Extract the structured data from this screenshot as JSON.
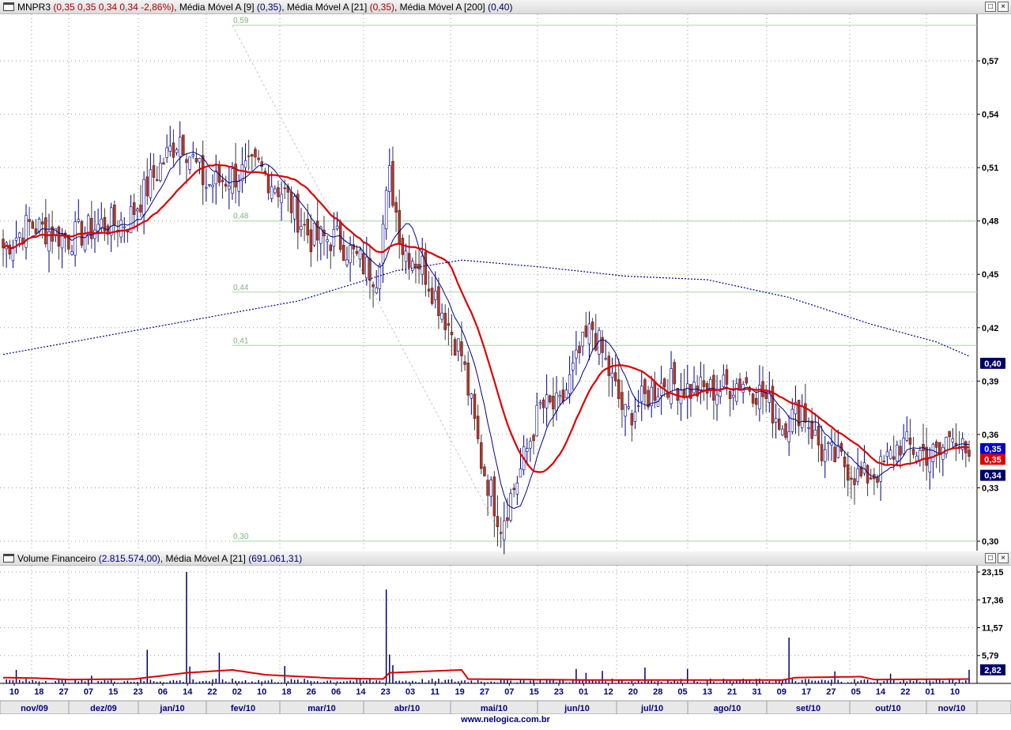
{
  "header": {
    "ticker": "MNPR3",
    "quote": "(0,35  0,35  0,34  0,34  -2,86%)",
    "ma9_label": "Média Móvel A [9]",
    "ma9_value": "(0,35)",
    "ma21_label": "Média Móvel A [21]",
    "ma21_value": "(0,35)",
    "ma200_label": "Média Móvel A [200]",
    "ma200_value": "(0,40)"
  },
  "volume_header": {
    "label": "Volume Financeiro",
    "value": "(2.815.574,00)",
    "ma21_label": "Média Móvel A [21]",
    "ma21_value": "(691.061,31)"
  },
  "footer": {
    "site": "www.nelogica.com.br"
  },
  "colors": {
    "up": "#ffffff",
    "up_border": "#00008b",
    "down": "#b03a2e",
    "ma9": "#00008b",
    "ma21": "#dd0000",
    "ma200": "#00008b",
    "fib": "#a8d6a8",
    "volume": "#00006b"
  },
  "chart_data": [
    {
      "type": "candlestick",
      "title": "MNPR3",
      "ylim": [
        0.3,
        0.59
      ],
      "y_ticks": [
        "0,57",
        "0,54",
        "0,51",
        "0,48",
        "0,45",
        "0,42",
        "0,39",
        "0,36",
        "0,33",
        "0,30"
      ],
      "fib_levels": [
        {
          "value": 0.59,
          "label": "0,59"
        },
        {
          "value": 0.48,
          "label": "0,48"
        },
        {
          "value": 0.44,
          "label": "0,44"
        },
        {
          "value": 0.41,
          "label": "0,41"
        },
        {
          "value": 0.3,
          "label": "0,30"
        }
      ],
      "last_value_badges": [
        {
          "label": "0,40",
          "value": 0.4,
          "color": "#000066"
        },
        {
          "label": "0,35",
          "value": 0.352,
          "color": "#0000cc"
        },
        {
          "label": "0,35",
          "value": 0.346,
          "color": "#dd0000"
        },
        {
          "label": "0,34",
          "value": 0.337,
          "color": "#000066"
        }
      ],
      "x_day_labels": [
        "10",
        "18",
        "27",
        "07",
        "15",
        "23",
        "06",
        "14",
        "22",
        "02",
        "10",
        "18",
        "26",
        "06",
        "14",
        "23",
        "03",
        "11",
        "19",
        "27",
        "07",
        "15",
        "23",
        "01",
        "12",
        "20",
        "28",
        "05",
        "13",
        "21",
        "31",
        "09",
        "17",
        "27",
        "05",
        "14",
        "22",
        "01",
        "10"
      ],
      "x_month_labels": [
        "nov/09",
        "dez/09",
        "jan/10",
        "fev/10",
        "mar/10",
        "abr/10",
        "mai/10",
        "jun/10",
        "jul/10",
        "ago/10",
        "set/10",
        "out/10",
        "nov/10"
      ],
      "close_anchors": [
        {
          "day": 0,
          "close": 0.465
        },
        {
          "day": 8,
          "close": 0.478
        },
        {
          "day": 20,
          "close": 0.47
        },
        {
          "day": 30,
          "close": 0.478
        },
        {
          "day": 38,
          "close": 0.48
        },
        {
          "day": 46,
          "close": 0.505
        },
        {
          "day": 54,
          "close": 0.528
        },
        {
          "day": 62,
          "close": 0.5
        },
        {
          "day": 70,
          "close": 0.505
        },
        {
          "day": 78,
          "close": 0.51
        },
        {
          "day": 86,
          "close": 0.495
        },
        {
          "day": 94,
          "close": 0.47
        },
        {
          "day": 102,
          "close": 0.47
        },
        {
          "day": 110,
          "close": 0.455
        },
        {
          "day": 114,
          "close": 0.45
        },
        {
          "day": 118,
          "close": 0.505
        },
        {
          "day": 122,
          "close": 0.465
        },
        {
          "day": 128,
          "close": 0.455
        },
        {
          "day": 134,
          "close": 0.43
        },
        {
          "day": 140,
          "close": 0.405
        },
        {
          "day": 146,
          "close": 0.345
        },
        {
          "day": 152,
          "close": 0.31
        },
        {
          "day": 158,
          "close": 0.34
        },
        {
          "day": 164,
          "close": 0.375
        },
        {
          "day": 170,
          "close": 0.375
        },
        {
          "day": 176,
          "close": 0.405
        },
        {
          "day": 180,
          "close": 0.42
        },
        {
          "day": 184,
          "close": 0.4
        },
        {
          "day": 190,
          "close": 0.37
        },
        {
          "day": 196,
          "close": 0.38
        },
        {
          "day": 202,
          "close": 0.39
        },
        {
          "day": 210,
          "close": 0.385
        },
        {
          "day": 218,
          "close": 0.385
        },
        {
          "day": 226,
          "close": 0.39
        },
        {
          "day": 232,
          "close": 0.382
        },
        {
          "day": 238,
          "close": 0.365
        },
        {
          "day": 244,
          "close": 0.375
        },
        {
          "day": 250,
          "close": 0.35
        },
        {
          "day": 256,
          "close": 0.345
        },
        {
          "day": 262,
          "close": 0.335
        },
        {
          "day": 268,
          "close": 0.34
        },
        {
          "day": 274,
          "close": 0.355
        },
        {
          "day": 280,
          "close": 0.35
        },
        {
          "day": 286,
          "close": 0.348
        },
        {
          "day": 290,
          "close": 0.365
        },
        {
          "day": 295,
          "close": 0.34
        }
      ],
      "ma200": [
        {
          "day": 0,
          "value": 0.405
        },
        {
          "day": 30,
          "value": 0.415
        },
        {
          "day": 60,
          "value": 0.425
        },
        {
          "day": 90,
          "value": 0.435
        },
        {
          "day": 120,
          "value": 0.452
        },
        {
          "day": 140,
          "value": 0.458
        },
        {
          "day": 165,
          "value": 0.454
        },
        {
          "day": 190,
          "value": 0.449
        },
        {
          "day": 215,
          "value": 0.447
        },
        {
          "day": 240,
          "value": 0.437
        },
        {
          "day": 265,
          "value": 0.422
        },
        {
          "day": 285,
          "value": 0.412
        },
        {
          "day": 295,
          "value": 0.404
        }
      ]
    },
    {
      "type": "bar",
      "title": "Volume Financeiro",
      "y_ticks": [
        "23,15",
        "17,36",
        "11,57",
        "5,79"
      ],
      "ylim": [
        0,
        23.15
      ],
      "last_value_badges": [
        {
          "label": "2,82",
          "value": 2.82,
          "color": "#000066"
        }
      ],
      "spikes": [
        {
          "day": 4,
          "value": 2.8
        },
        {
          "day": 27,
          "value": 1.6
        },
        {
          "day": 44,
          "value": 7.0
        },
        {
          "day": 56,
          "value": 23.15
        },
        {
          "day": 57,
          "value": 3.5
        },
        {
          "day": 66,
          "value": 6.4
        },
        {
          "day": 86,
          "value": 3.6
        },
        {
          "day": 117,
          "value": 19.5
        },
        {
          "day": 118,
          "value": 6.0
        },
        {
          "day": 119,
          "value": 3.8
        },
        {
          "day": 175,
          "value": 3.0
        },
        {
          "day": 178,
          "value": 2.2
        },
        {
          "day": 183,
          "value": 2.6
        },
        {
          "day": 196,
          "value": 3.3
        },
        {
          "day": 209,
          "value": 3.0
        },
        {
          "day": 240,
          "value": 9.5
        },
        {
          "day": 254,
          "value": 2.5
        },
        {
          "day": 271,
          "value": 2.0
        },
        {
          "day": 295,
          "value": 2.82
        }
      ],
      "ma21": [
        {
          "day": 0,
          "value": 1.2
        },
        {
          "day": 10,
          "value": 1.1
        },
        {
          "day": 20,
          "value": 0.8
        },
        {
          "day": 40,
          "value": 0.9
        },
        {
          "day": 56,
          "value": 2.2
        },
        {
          "day": 70,
          "value": 2.8
        },
        {
          "day": 80,
          "value": 1.8
        },
        {
          "day": 100,
          "value": 1.1
        },
        {
          "day": 116,
          "value": 0.9
        },
        {
          "day": 118,
          "value": 2.2
        },
        {
          "day": 140,
          "value": 2.8
        },
        {
          "day": 142,
          "value": 0.9
        },
        {
          "day": 180,
          "value": 0.7
        },
        {
          "day": 238,
          "value": 0.7
        },
        {
          "day": 242,
          "value": 1.2
        },
        {
          "day": 262,
          "value": 1.4
        },
        {
          "day": 266,
          "value": 0.8
        },
        {
          "day": 295,
          "value": 0.9
        }
      ]
    }
  ]
}
